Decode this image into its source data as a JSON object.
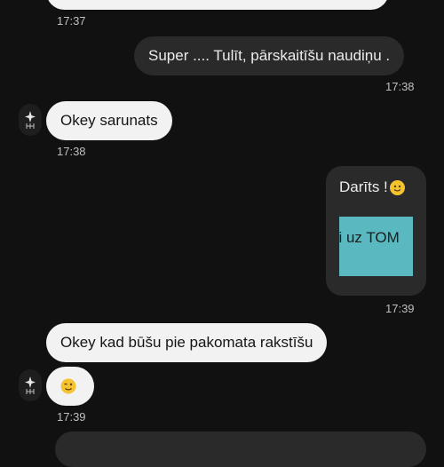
{
  "messages": [
    {
      "text": "",
      "time": "17:37"
    },
    {
      "text": "Super .... Tulīt, pārskaitīšu naudiņu .",
      "time": "17:38"
    },
    {
      "text": "Okey sarunats",
      "time": "17:38"
    },
    {
      "caption": "Darīts !",
      "image_text": "īti uz TOM",
      "time": "17:39"
    },
    {
      "text": "Okey kad būšu pie pakomata rakstīšu"
    },
    {
      "emoji": "winking-face",
      "time": "17:39"
    }
  ],
  "colors": {
    "background": "#111111",
    "incoming_bubble": "#f2f2f2",
    "outgoing_bubble": "#2a2a2a",
    "image_fill": "#59b8c0",
    "emoji_yellow": "#f5c330"
  }
}
